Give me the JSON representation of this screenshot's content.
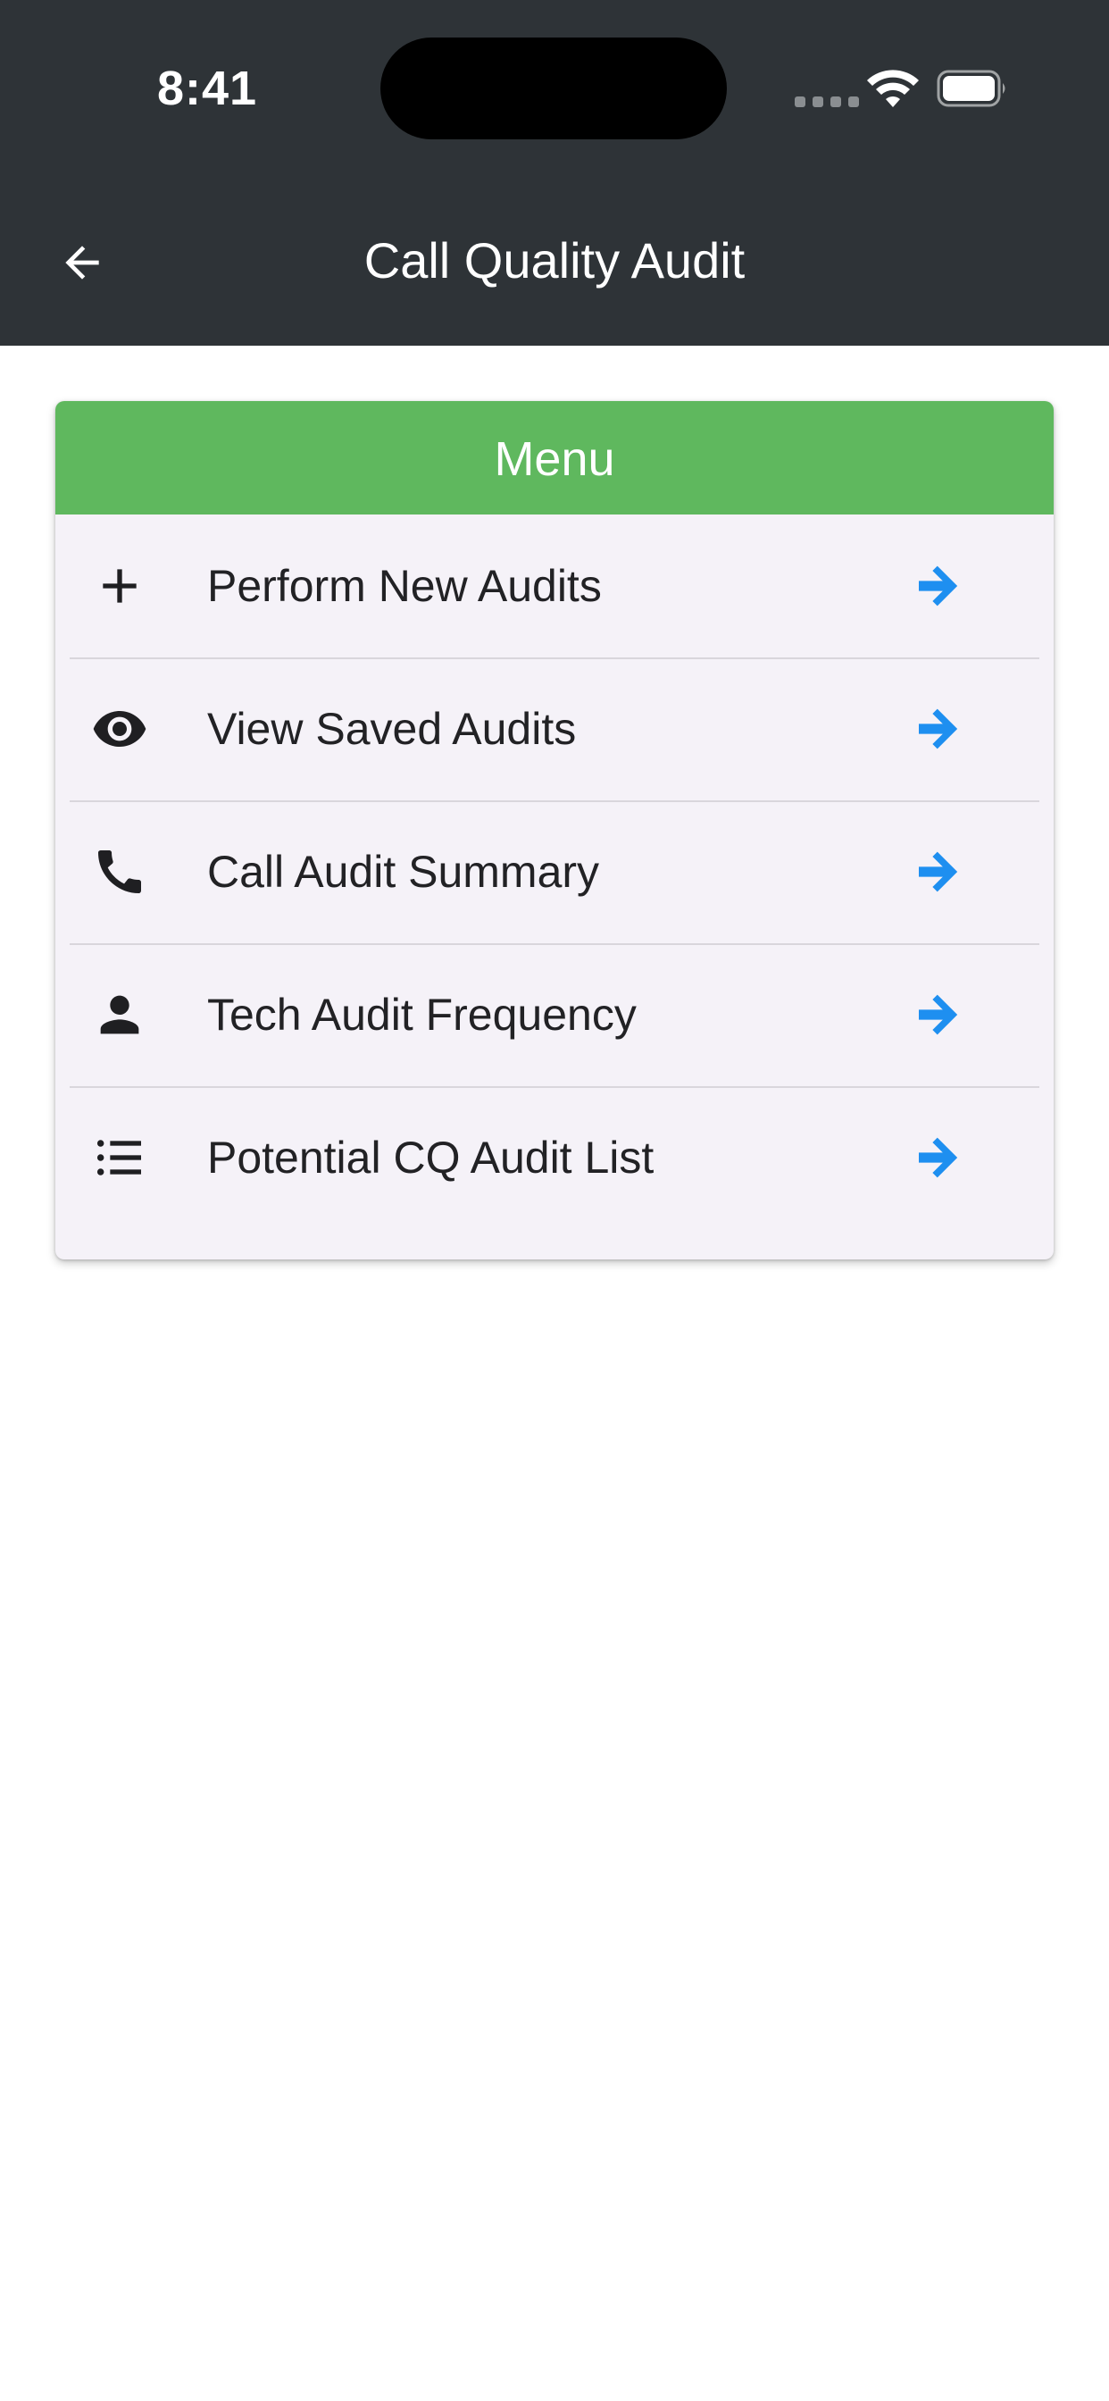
{
  "status_bar": {
    "time": "8:41",
    "icons": [
      "cellular-signal-icon",
      "wifi-icon",
      "battery-icon"
    ]
  },
  "app_bar": {
    "title": "Call Quality Audit",
    "back_icon": "arrow-left-icon"
  },
  "menu": {
    "header": "Menu",
    "items": [
      {
        "label": "Perform New Audits",
        "icon": "plus-icon"
      },
      {
        "label": "View Saved Audits",
        "icon": "eye-icon"
      },
      {
        "label": "Call Audit Summary",
        "icon": "phone-icon"
      },
      {
        "label": "Tech Audit Frequency",
        "icon": "person-icon"
      },
      {
        "label": "Potential CQ Audit List",
        "icon": "list-icon"
      }
    ],
    "arrow_icon": "arrow-right-icon"
  },
  "colors": {
    "app_bar": "#2e3337",
    "menu_header": "#5fb85e",
    "card_background": "#f5f2f8",
    "arrow": "#1e8ff0"
  }
}
